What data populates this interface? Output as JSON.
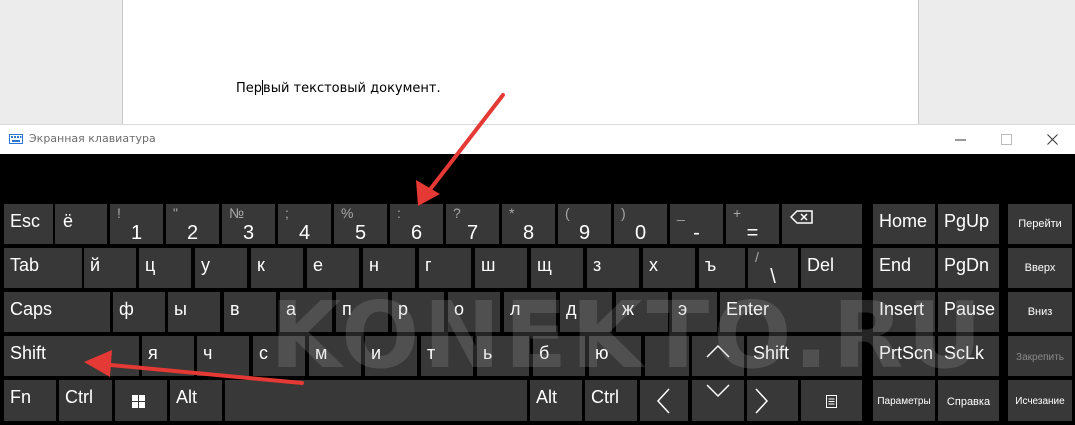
{
  "document": {
    "text_before_caret": "Пер",
    "text_after_caret": "вый текстовый документ."
  },
  "osk": {
    "title": "Экранная клавиатура",
    "rows": {
      "row1": [
        {
          "id": "esc",
          "label": "Esc"
        },
        {
          "id": "yo",
          "label": "ё"
        },
        {
          "id": "1",
          "sym": "!",
          "num": "1"
        },
        {
          "id": "2",
          "sym": "\"",
          "num": "2"
        },
        {
          "id": "3",
          "sym": "№",
          "num": "3"
        },
        {
          "id": "4",
          "sym": ";",
          "num": "4"
        },
        {
          "id": "5",
          "sym": "%",
          "num": "5"
        },
        {
          "id": "6",
          "sym": ":",
          "num": "6"
        },
        {
          "id": "7",
          "sym": "?",
          "num": "7"
        },
        {
          "id": "8",
          "sym": "*",
          "num": "8"
        },
        {
          "id": "9",
          "sym": "(",
          "num": "9"
        },
        {
          "id": "0",
          "sym": ")",
          "num": "0"
        },
        {
          "id": "minus",
          "sym": "_",
          "num": "-"
        },
        {
          "id": "plus",
          "sym": "+",
          "num": "="
        }
      ],
      "row2": [
        {
          "id": "tab",
          "label": "Tab"
        },
        {
          "id": "y",
          "label": "й"
        },
        {
          "id": "ts",
          "label": "ц"
        },
        {
          "id": "u",
          "label": "у"
        },
        {
          "id": "k",
          "label": "к"
        },
        {
          "id": "e",
          "label": "е"
        },
        {
          "id": "n",
          "label": "н"
        },
        {
          "id": "g",
          "label": "г"
        },
        {
          "id": "sh",
          "label": "ш"
        },
        {
          "id": "shch",
          "label": "щ"
        },
        {
          "id": "z",
          "label": "з"
        },
        {
          "id": "kh",
          "label": "х"
        },
        {
          "id": "hard",
          "label": "ъ"
        },
        {
          "id": "bslash",
          "sym": "/",
          "num": "\\"
        },
        {
          "id": "del",
          "label": "Del"
        }
      ],
      "row3": [
        {
          "id": "caps",
          "label": "Caps"
        },
        {
          "id": "f",
          "label": "ф"
        },
        {
          "id": "yy",
          "label": "ы"
        },
        {
          "id": "v",
          "label": "в"
        },
        {
          "id": "a",
          "label": "а"
        },
        {
          "id": "p",
          "label": "п"
        },
        {
          "id": "r",
          "label": "р"
        },
        {
          "id": "o",
          "label": "о"
        },
        {
          "id": "l",
          "label": "л"
        },
        {
          "id": "d",
          "label": "д"
        },
        {
          "id": "zh",
          "label": "ж"
        },
        {
          "id": "ee",
          "label": "э"
        },
        {
          "id": "enter",
          "label": "Enter"
        }
      ],
      "row4": [
        {
          "id": "shift-l",
          "label": "Shift"
        },
        {
          "id": "ya",
          "label": "я"
        },
        {
          "id": "ch",
          "label": "ч"
        },
        {
          "id": "s",
          "label": "с"
        },
        {
          "id": "m",
          "label": "м"
        },
        {
          "id": "i",
          "label": "и"
        },
        {
          "id": "t",
          "label": "т"
        },
        {
          "id": "soft",
          "label": "ь"
        },
        {
          "id": "b",
          "label": "б"
        },
        {
          "id": "yu",
          "label": "ю"
        },
        {
          "id": "shift-r",
          "label": "Shift"
        }
      ],
      "row5": [
        {
          "id": "fn",
          "label": "Fn"
        },
        {
          "id": "ctrl-l",
          "label": "Ctrl"
        },
        {
          "id": "alt-l",
          "label": "Alt"
        },
        {
          "id": "alt-r",
          "label": "Alt"
        },
        {
          "id": "ctrl-r",
          "label": "Ctrl"
        }
      ]
    },
    "nav": {
      "home": "Home",
      "pgup": "PgUp",
      "goto": "Перейти",
      "end": "End",
      "pgdn": "PgDn",
      "up": "Вверх",
      "insert": "Insert",
      "pause": "Pause",
      "down": "Вниз",
      "prtscn": "PrtScn",
      "sclk": "ScLk",
      "pin": "Закрепить",
      "options": "Параметры",
      "help": "Справка",
      "fade": "Исчезание"
    },
    "watermark": "KONEKTO.RU",
    "colors": {
      "key": "#383838",
      "background": "#000000",
      "arrow": "#e53935"
    }
  }
}
